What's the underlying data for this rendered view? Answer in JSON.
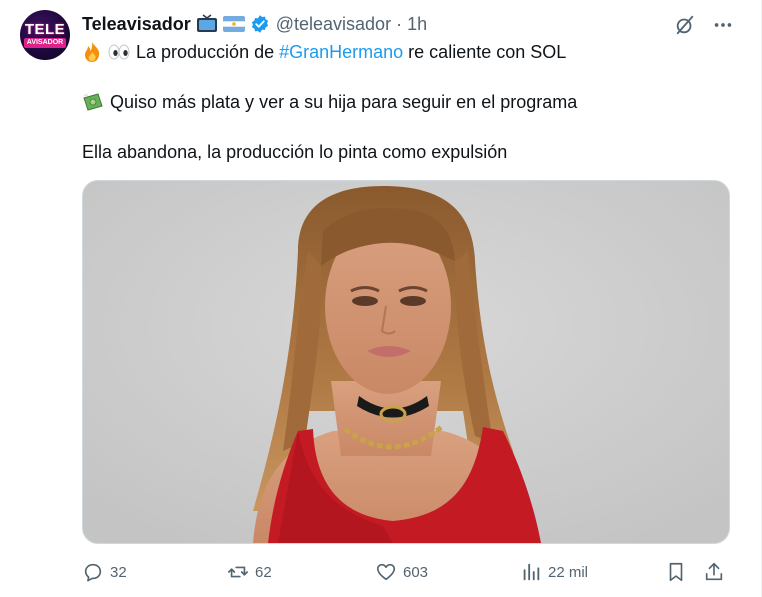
{
  "tweet": {
    "display_name": "Teleavisador",
    "handle": "@teleavisador",
    "separator": "·",
    "time": "1h",
    "avatar": {
      "top": "TELE",
      "bottom": "AVISADOR"
    },
    "line1": {
      "before": "La producción de ",
      "hashtag": "#GranHermano",
      "after": " re caliente con SOL"
    },
    "line2": "Quiso más plata y ver a su hija para seguir en el programa",
    "line3": "Ella abandona, la producción lo pinta como expulsión"
  },
  "actions": {
    "replies": "32",
    "reposts": "62",
    "likes": "603",
    "views": "22 mil"
  },
  "colors": {
    "hashtag": "#1d9bf0",
    "secondary_text": "#536471",
    "verified": "#1d9bf0",
    "media_background": "#cfcfcf",
    "dress": "#c41a24"
  }
}
